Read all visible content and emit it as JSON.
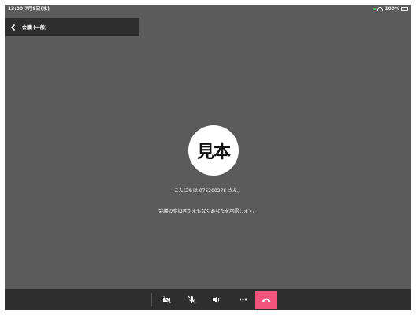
{
  "status_bar": {
    "time": "13:00  7月8日(水)",
    "battery": "100%"
  },
  "header": {
    "title": "会議 (一般)"
  },
  "main": {
    "avatar_text": "見本",
    "greeting": "こんにちは 07520027S さん。",
    "waiting_message": "会議の参加者がまもなくあなたを承認します。"
  },
  "toolbar": {
    "icons": [
      "video-off-icon",
      "mic-off-icon",
      "speaker-icon",
      "more-icon",
      "hang-up-icon"
    ],
    "end_call_color": "#f2547d"
  },
  "colors": {
    "background": "#5b5b5b",
    "bars": "#2e2e2e"
  }
}
